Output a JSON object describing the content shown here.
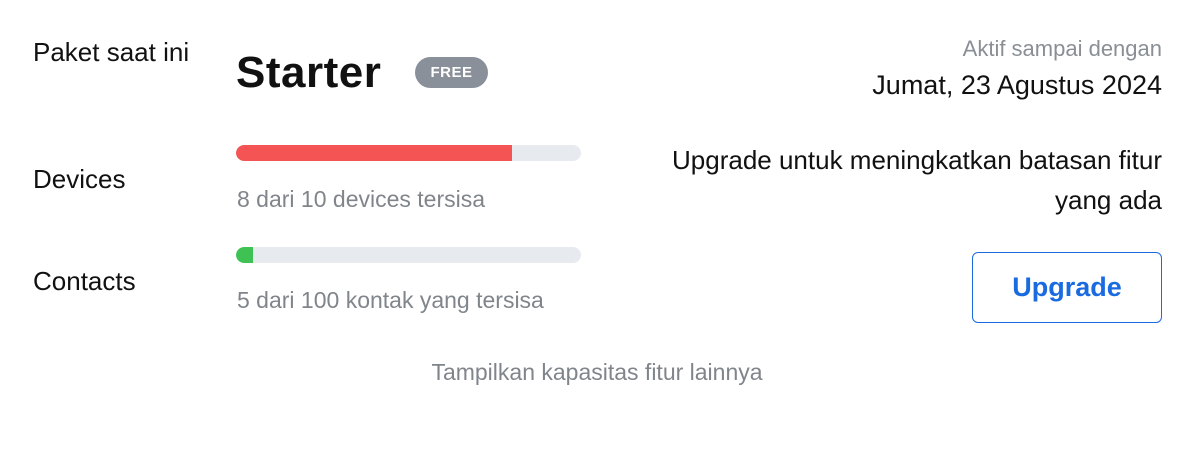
{
  "plan": {
    "label": "Paket saat ini",
    "name": "Starter",
    "badge": "FREE",
    "badge_color": "#8a9099"
  },
  "active": {
    "label": "Aktif sampai dengan",
    "date": "Jumat, 23 Agustus 2024"
  },
  "usage": [
    {
      "label": "Devices",
      "text": "8 dari 10 devices tersisa",
      "fill_fraction": 0.8,
      "fill_color": "#f45454"
    },
    {
      "label": "Contacts",
      "text": "5 dari 100 kontak yang tersisa",
      "fill_fraction": 0.05,
      "fill_color": "#3fc254"
    }
  ],
  "upgrade": {
    "message": "Upgrade untuk meningkatkan batasan fitur yang ada",
    "button_label": "Upgrade",
    "accent_color": "#1a6be0"
  },
  "footer": {
    "more_link": "Tampilkan kapasitas fitur lainnya"
  },
  "colors": {
    "track": "#e7eaee",
    "muted_text": "#80858c"
  }
}
